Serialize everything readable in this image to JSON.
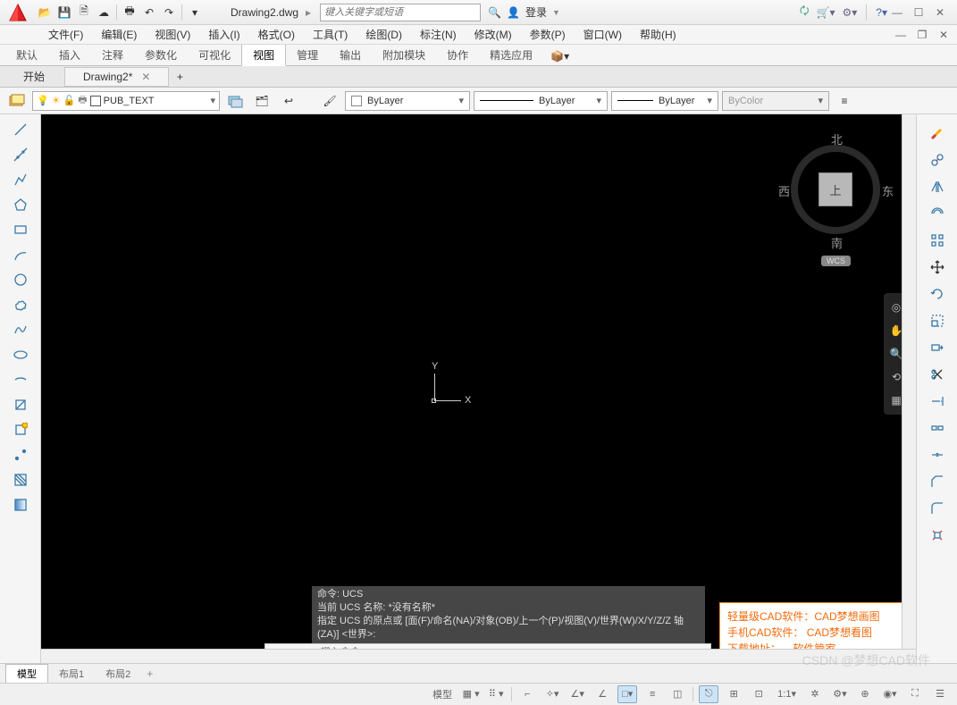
{
  "title": {
    "doc": "Drawing2.dwg",
    "search_placeholder": "键入关键字或短语",
    "login": "登录"
  },
  "menus": [
    "文件(F)",
    "编辑(E)",
    "视图(V)",
    "插入(I)",
    "格式(O)",
    "工具(T)",
    "绘图(D)",
    "标注(N)",
    "修改(M)",
    "参数(P)",
    "窗口(W)",
    "帮助(H)"
  ],
  "ribbon_tabs": [
    "默认",
    "插入",
    "注释",
    "参数化",
    "可视化",
    "视图",
    "管理",
    "输出",
    "附加模块",
    "协作",
    "精选应用"
  ],
  "ribbon_active": "视图",
  "file_tabs": {
    "start": "开始",
    "docs": [
      "Drawing2*"
    ]
  },
  "layer_bar": {
    "current_layer": "PUB_TEXT",
    "color": "ByLayer",
    "lineweight": "ByLayer",
    "linetype": "ByLayer",
    "bycolor": "ByColor"
  },
  "ucs": {
    "x": "X",
    "y": "Y"
  },
  "viewcube": {
    "top": "上",
    "n": "北",
    "s": "南",
    "w": "西",
    "e": "东",
    "wcs": "WCS"
  },
  "cmd": {
    "line1": "命令: UCS",
    "line2": "当前 UCS 名称: *没有名称*",
    "line3": "指定 UCS 的原点或 [面(F)/命名(NA)/对象(OB)/上一个(P)/视图(V)/世界(W)/X/Y/Z/Z 轴(ZA)] <世界>:",
    "placeholder": "键入命令"
  },
  "promo": {
    "l1a": "轻量级CAD软件：",
    "l1b": "CAD梦想画图",
    "l2a": "手机CAD软件：",
    "l2b": "CAD梦想看图",
    "l3a": "下载地址：",
    "l3b": "软件管家"
  },
  "layout_tabs": {
    "model": "模型",
    "layouts": [
      "布局1",
      "布局2"
    ]
  },
  "status": {
    "model": "模型",
    "scale": "1:1",
    "watermark": "CSDN @梦想CAD软件"
  }
}
